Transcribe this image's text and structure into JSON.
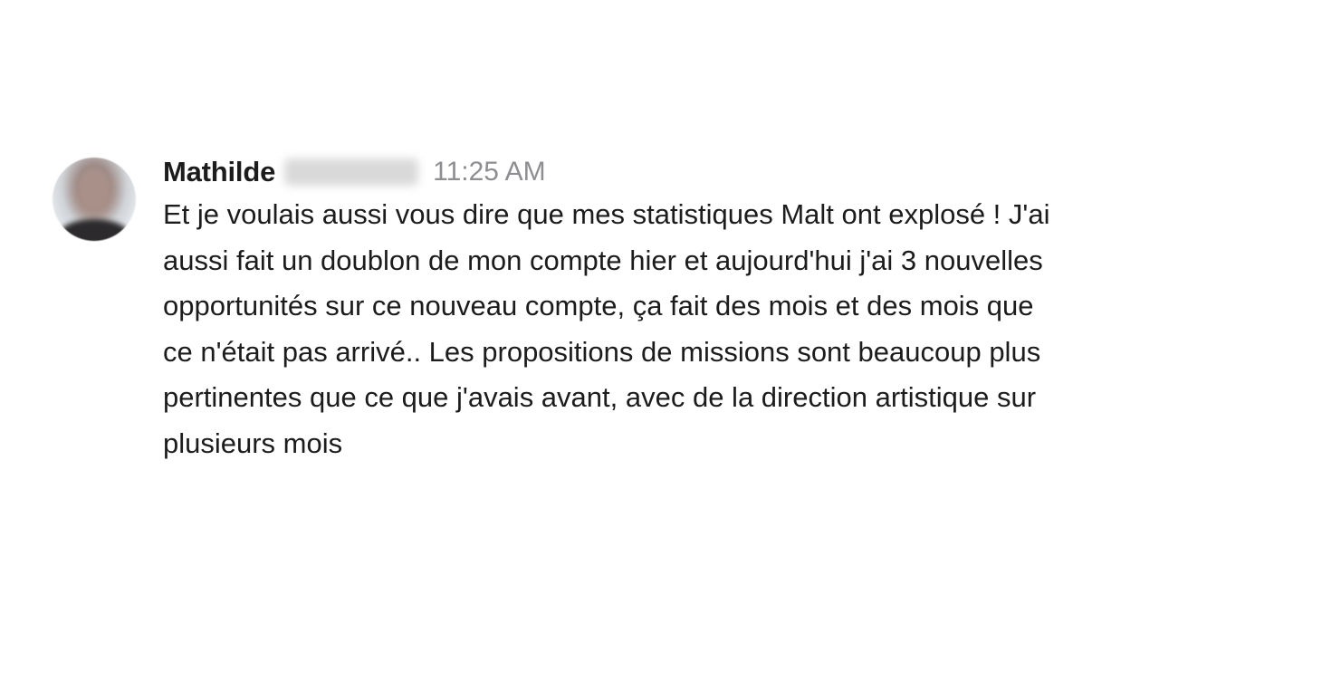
{
  "message": {
    "sender_name": "Mathilde",
    "timestamp": "11:25 AM",
    "lines": [
      "Et je voulais aussi vous dire que mes statistiques Malt ont explosé ! J'ai",
      "aussi fait un doublon de mon compte hier et aujourd'hui j'ai 3 nouvelles",
      "opportunités sur ce nouveau compte, ça fait des mois et des mois que",
      "ce n'était pas arrivé.. Les propositions de missions sont beaucoup plus",
      "pertinentes que ce que j'avais avant, avec de la direction artistique sur",
      "plusieurs mois"
    ]
  }
}
